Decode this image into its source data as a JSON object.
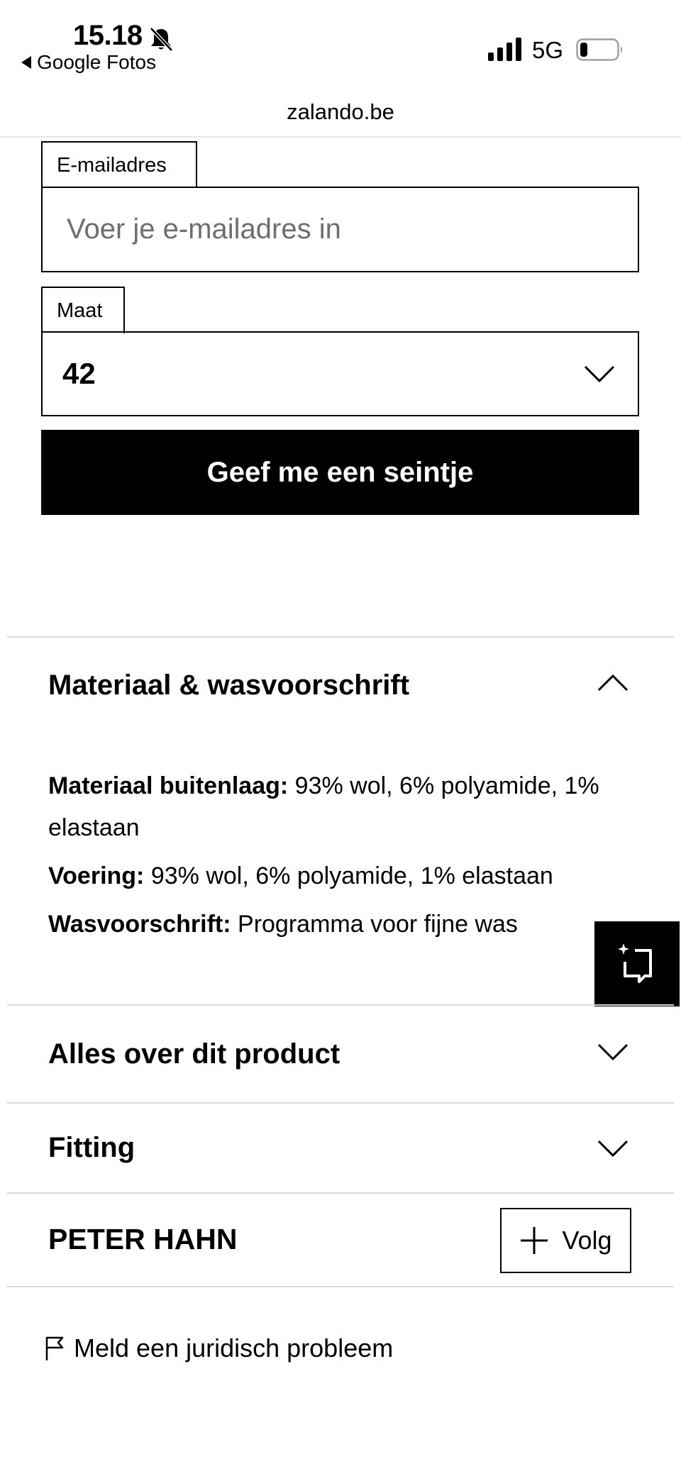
{
  "status_bar": {
    "time": "15.18",
    "back_app": "Google Fotos",
    "network": "5G"
  },
  "browser": {
    "url": "zalando.be"
  },
  "form": {
    "email_label": "E-mailadres",
    "email_placeholder": "Voer je e-mailadres in",
    "email_value": "",
    "size_label": "Maat",
    "size_value": "42",
    "submit_label": "Geef me een seintje"
  },
  "sections": {
    "material": {
      "title": "Materiaal & wasvoorschrift",
      "expanded": true,
      "items": [
        {
          "label": "Materiaal buitenlaag:",
          "value": "93% wol, 6% polyamide, 1% elastaan"
        },
        {
          "label": "Voering:",
          "value": "93% wol, 6% polyamide, 1% elastaan"
        },
        {
          "label": "Wasvoorschrift:",
          "value": "Programma voor fijne was"
        }
      ]
    },
    "about": {
      "title": "Alles over dit product",
      "expanded": false
    },
    "fitting": {
      "title": "Fitting",
      "expanded": false
    }
  },
  "brand": {
    "name": "PETER HAHN",
    "follow_label": "Volg"
  },
  "legal": {
    "label": "Meld een juridisch probleem"
  },
  "icons": {
    "bell": "bell-muted-icon",
    "signal": "cellular-signal-icon",
    "battery": "battery-icon",
    "feedback": "feedback-sparkle-icon",
    "flag": "flag-icon"
  }
}
